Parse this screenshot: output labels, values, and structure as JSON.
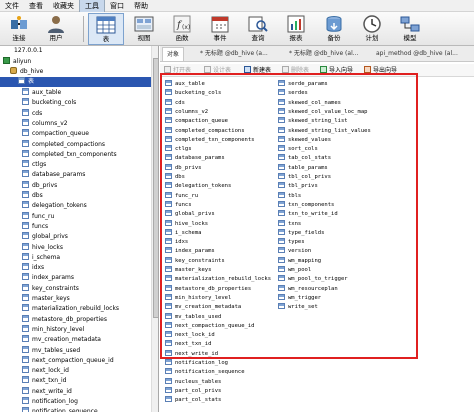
{
  "menu": {
    "items": [
      "文件",
      "查看",
      "收藏夹",
      "工具",
      "窗口",
      "帮助"
    ],
    "active_index": 3
  },
  "toolbar": {
    "buttons": [
      {
        "label": "连接",
        "icon": "connect-icon"
      },
      {
        "label": "用户",
        "icon": "user-icon"
      },
      {
        "label": "表",
        "icon": "table-icon"
      },
      {
        "label": "视图",
        "icon": "view-icon"
      },
      {
        "label": "函数",
        "icon": "function-icon"
      },
      {
        "label": "事件",
        "icon": "event-icon"
      },
      {
        "label": "查询",
        "icon": "query-icon"
      },
      {
        "label": "报表",
        "icon": "report-icon"
      },
      {
        "label": "备份",
        "icon": "backup-icon"
      },
      {
        "label": "计划",
        "icon": "schedule-icon"
      },
      {
        "label": "模型",
        "icon": "model-icon"
      }
    ],
    "selected_index": 2
  },
  "tree": {
    "connection": "127.0.0.1",
    "server": "aliyun",
    "database": "db_hive",
    "tables_node": "表",
    "tables": [
      "aux_table",
      "bucketing_cols",
      "cds",
      "columns_v2",
      "compaction_queue",
      "completed_compactions",
      "completed_txn_components",
      "ctlgs",
      "database_params",
      "db_privs",
      "dbs",
      "delegation_tokens",
      "func_ru",
      "funcs",
      "global_privs",
      "hive_locks",
      "i_schema",
      "idxs",
      "index_params",
      "key_constraints",
      "master_keys",
      "materialization_rebuild_locks",
      "metastore_db_properties",
      "min_history_level",
      "mv_creation_metadata",
      "mv_tables_used",
      "next_compaction_queue_id",
      "next_lock_id",
      "next_txn_id",
      "next_write_id",
      "notification_log",
      "notification_sequence"
    ]
  },
  "tabs": {
    "first": "对象",
    "items": [
      "* 无标题 @db_hive (a...",
      "* 无标题 @db_hive (al...",
      "api_method @db_hive (al..."
    ]
  },
  "object_toolbar": {
    "open": "打开表",
    "design": "设计表",
    "new": "新建表",
    "delete": "删除表",
    "import": "导入向导",
    "export": "导出向导"
  },
  "objects": {
    "col1": [
      "aux_table",
      "bucketing_cols",
      "cds",
      "columns_v2",
      "compaction_queue",
      "completed_compactions",
      "completed_txn_components",
      "ctlgs",
      "database_params",
      "db_privs",
      "dbs",
      "delegation_tokens",
      "func_ru",
      "funcs",
      "global_privs",
      "hive_locks",
      "i_schema",
      "idxs",
      "index_params",
      "key_constraints",
      "master_keys",
      "materialization_rebuild_locks",
      "metastore_db_properties",
      "min_history_level",
      "mv_creation_metadata",
      "mv_tables_used",
      "next_compaction_queue_id",
      "next_lock_id",
      "next_txn_id",
      "next_write_id",
      "notification_log",
      "notification_sequence",
      "nucleus_tables",
      "part_col_privs",
      "part_col_stats"
    ],
    "col2": [
      "serde_params",
      "serdes",
      "skewed_col_names",
      "skewed_col_value_loc_map",
      "skewed_string_list",
      "skewed_string_list_values",
      "skewed_values",
      "sort_cols",
      "tab_col_stats",
      "table_params",
      "tbl_col_privs",
      "tbl_privs",
      "tbls",
      "txn_components",
      "txn_to_write_id",
      "txns",
      "type_fields",
      "types",
      "version",
      "wm_mapping",
      "wm_pool",
      "wm_pool_to_trigger",
      "wm_resourceplan",
      "wm_trigger",
      "write_set"
    ]
  },
  "colors": {
    "highlight": "#2a56b0",
    "annotation": "#e02020"
  }
}
